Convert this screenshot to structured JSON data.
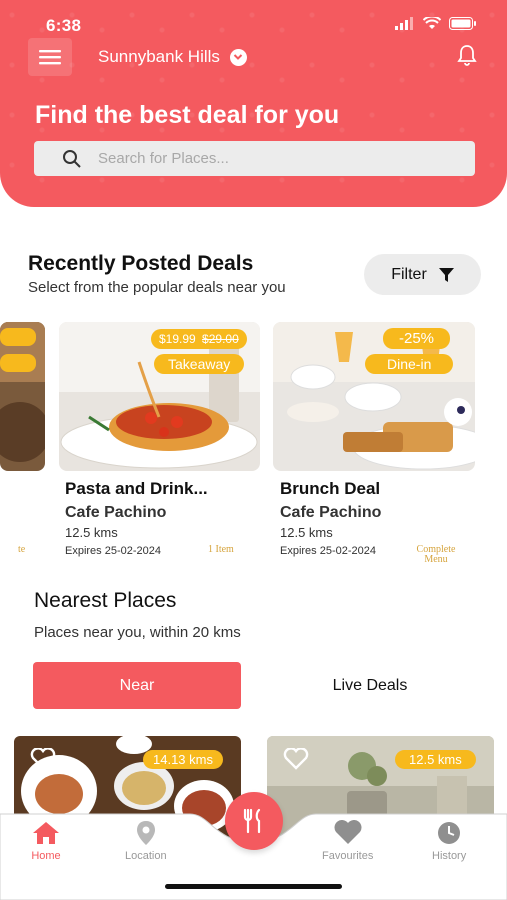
{
  "status": {
    "time": "6:38"
  },
  "header": {
    "location": "Sunnybank Hills",
    "headline": "Find the best deal for you",
    "search_placeholder": "Search for Places..."
  },
  "recent": {
    "title": "Recently Posted Deals",
    "subtitle": "Select from the popular deals near you",
    "filter_label": "Filter"
  },
  "deals": [
    {
      "title": "Pasta and Drink...",
      "cafe": "Cafe Pachino",
      "distance": "12.5 kms",
      "expires": "Expires 25-02-2024",
      "price_new": "$19.99",
      "price_old": "$29.00",
      "tag": "Takeaway",
      "note": "1 Item"
    },
    {
      "title": "Brunch Deal",
      "cafe": "Cafe Pachino",
      "distance": "12.5 kms",
      "expires": "Expires 25-02-2024",
      "discount": "-25%",
      "tag": "Dine-in",
      "note_line1": "Complete",
      "note_line2": "Menu"
    }
  ],
  "partial_deal_note": "te",
  "nearest": {
    "title": "Nearest Places",
    "subtitle": "Places near you, within 20 kms",
    "tab_near": "Near",
    "tab_live": "Live Deals"
  },
  "places": [
    {
      "distance": "14.13 kms"
    },
    {
      "distance": "12.5 kms"
    }
  ],
  "nav": {
    "home": "Home",
    "location": "Location",
    "favourites": "Favourites",
    "history": "History"
  },
  "colors": {
    "accent": "#f45a5f",
    "badge": "#f7b91d"
  }
}
